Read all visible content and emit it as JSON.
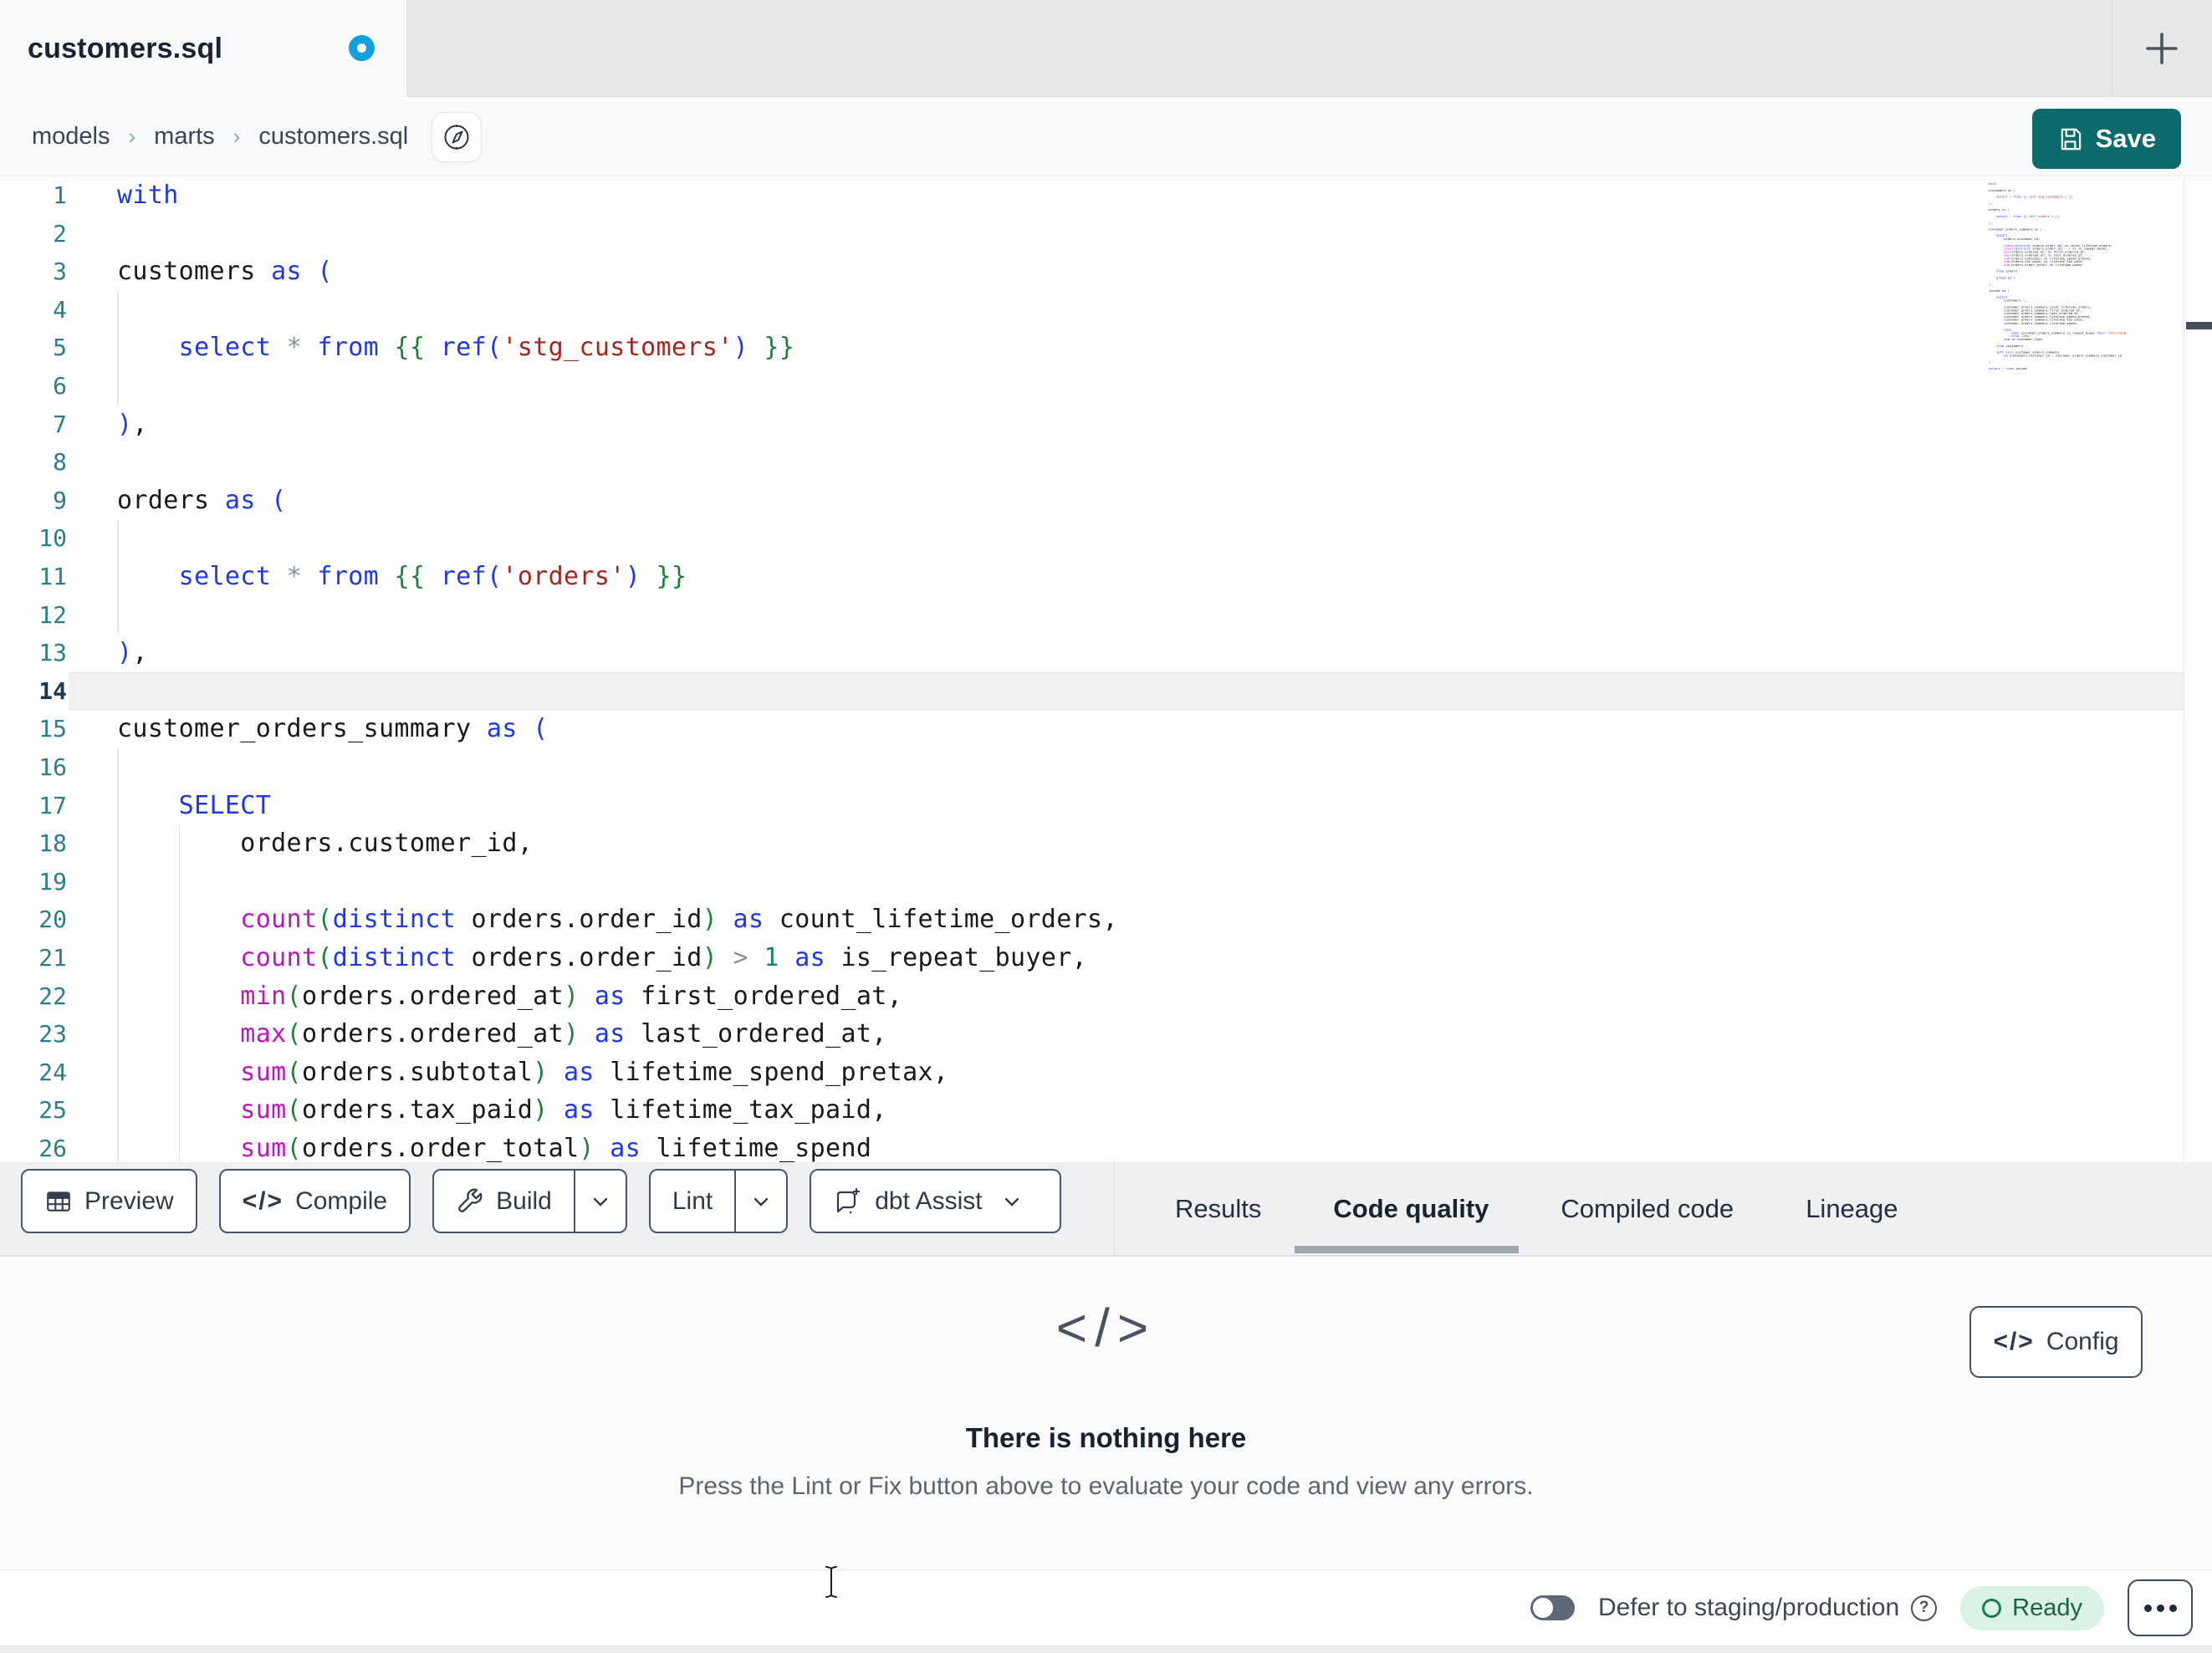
{
  "tabbar": {
    "tab_title": "customers.sql",
    "new_tab_label": "+"
  },
  "breadcrumb": {
    "items": [
      "models",
      "marts",
      "customers.sql"
    ],
    "separator": "›"
  },
  "header": {
    "save_label": "Save"
  },
  "editor": {
    "first_line_number": 1,
    "active_line": 14,
    "visible_line_count": 26,
    "colors": {
      "kw": "#2038E0",
      "fn": "#BE16BE",
      "str": "#A3261F",
      "pOdd": "#2038E0",
      "pEven": "#1F8038",
      "num": "#18866B",
      "op": "#8A9199",
      "tx": "#17191D",
      "line_number": "#2C7D8C",
      "active_line_number": "#1B3B52",
      "active_line_bg": "#F1F1F2"
    },
    "lines": [
      "with",
      "",
      "customers as (",
      "",
      "    select * from {{ ref('stg_customers') }}",
      "",
      "),",
      "",
      "orders as (",
      "",
      "    select * from {{ ref('orders') }}",
      "",
      "),",
      "",
      "customer_orders_summary as (",
      "",
      "    SELECT",
      "        orders.customer_id,",
      "",
      "        count(distinct orders.order_id) as count_lifetime_orders,",
      "        count(distinct orders.order_id) > 1 as is_repeat_buyer,",
      "        min(orders.ordered_at) as first_ordered_at,",
      "        max(orders.ordered_at) as last_ordered_at,",
      "        sum(orders.subtotal) as lifetime_spend_pretax,",
      "        sum(orders.tax_paid) as lifetime_tax_paid,",
      "        sum(orders.order_total) as lifetime_spend"
    ],
    "minimap_continuation_lines": [
      "",
      "    from orders",
      "",
      "    group by 1",
      "",
      "),",
      "",
      "joined as (",
      "",
      "    select",
      "        customers.*,",
      "",
      "        customer_orders_summary.count_lifetime_orders,",
      "        customer_orders_summary.first_ordered_at,",
      "        customer_orders_summary.last_ordered_at,",
      "        customer_orders_summary.lifetime_spend_pretax,",
      "        customer_orders_summary.lifetime_tax_paid,",
      "        customer_orders_summary.lifetime_spend,",
      "",
      "        case",
      "            when customer_orders_summary.is_repeat_buyer then 'returning'",
      "            else 'new'",
      "        end as customer_type",
      "",
      "    from customers",
      "",
      "    left join customer_orders_summary",
      "        on customers.customer_id = customer_orders_summary.customer_id",
      "",
      ")",
      "",
      "select * from joined"
    ]
  },
  "toolbar": {
    "buttons": [
      {
        "label": "Preview",
        "icon": "table-icon"
      },
      {
        "label": "Compile",
        "icon": "code-icon"
      },
      {
        "label": "Build",
        "icon": "wrench-icon",
        "split": true
      },
      {
        "label": "Lint",
        "split": true
      },
      {
        "label": "dbt Assist",
        "icon": "assist-icon",
        "chevron": true
      }
    ]
  },
  "panel_tabs": {
    "tabs": [
      "Results",
      "Code quality",
      "Compiled code",
      "Lineage"
    ],
    "active": "Code quality"
  },
  "results_panel": {
    "icon_glyph": "</>",
    "title": "There is nothing here",
    "subtitle": "Press the Lint or Fix button above to evaluate your code and view any errors.",
    "config_label": "Config",
    "config_glyph": "</>"
  },
  "statusbar": {
    "defer_label": "Defer to staging/production",
    "ready_label": "Ready"
  },
  "theme": {
    "save_button_teal": "#0D6B6B",
    "dirty_dot_blue": "#13A0DE",
    "ready_bg_green": "#DBF3E6",
    "ready_text_green": "#186443",
    "tabbar_gray": "#E6E7E9",
    "toolbar_gray": "#EEF0F2"
  }
}
